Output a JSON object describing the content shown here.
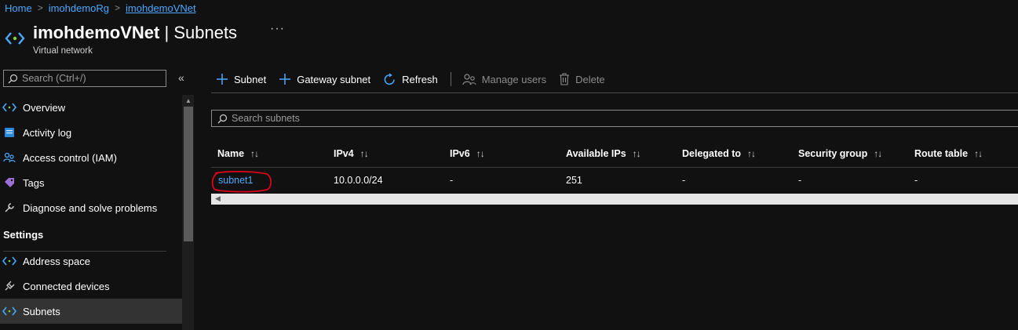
{
  "breadcrumb": {
    "home": "Home",
    "resource_group": "imohdemoRg",
    "current": "imohdemoVNet",
    "separator": ">"
  },
  "header": {
    "resource_name": "imohdemoVNet",
    "divider": "|",
    "blade": "Subnets",
    "more": "···",
    "subtitle": "Virtual network"
  },
  "nav": {
    "search_placeholder": "Search (Ctrl+/)",
    "collapse": "«",
    "items": [
      {
        "label": "Overview",
        "icon": "vnet-icon"
      },
      {
        "label": "Activity log",
        "icon": "activity-log-icon"
      },
      {
        "label": "Access control (IAM)",
        "icon": "people-icon"
      },
      {
        "label": "Tags",
        "icon": "tag-icon"
      },
      {
        "label": "Diagnose and solve problems",
        "icon": "wrench-icon"
      }
    ],
    "section_settings": "Settings",
    "settings_items": [
      {
        "label": "Address space",
        "icon": "vnet-icon"
      },
      {
        "label": "Connected devices",
        "icon": "plug-icon"
      },
      {
        "label": "Subnets",
        "icon": "vnet-icon",
        "selected": true
      }
    ]
  },
  "toolbar": {
    "add_subnet": "Subnet",
    "add_gateway_subnet": "Gateway subnet",
    "refresh": "Refresh",
    "manage_users": "Manage users",
    "delete": "Delete"
  },
  "filter": {
    "placeholder": "Search subnets"
  },
  "table": {
    "columns": [
      "Name",
      "IPv4",
      "IPv6",
      "Available IPs",
      "Delegated to",
      "Security group",
      "Route table"
    ],
    "sort_glyph": "↑↓",
    "rows": [
      {
        "name": "subnet1",
        "ipv4": "10.0.0.0/24",
        "ipv6": "-",
        "available_ips": "251",
        "delegated_to": "-",
        "security_group": "-",
        "route_table": "-"
      }
    ]
  },
  "colors": {
    "accent": "#4aa8ff",
    "background": "#111111",
    "annotation": "#e0001a"
  }
}
